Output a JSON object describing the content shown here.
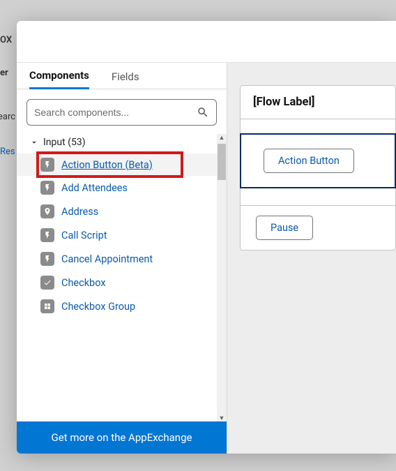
{
  "bg": {
    "left1": "OX",
    "left2": "er",
    "left3": "earc",
    "left4": "Res"
  },
  "tabs": {
    "components": "Components",
    "fields": "Fields"
  },
  "search": {
    "placeholder": "Search components..."
  },
  "section": {
    "label": "Input (53)"
  },
  "items": [
    {
      "label": "Action Button (Beta)",
      "icon": "bolt",
      "highlight": true
    },
    {
      "label": "Add Attendees",
      "icon": "bolt"
    },
    {
      "label": "Address",
      "icon": "pin"
    },
    {
      "label": "Call Script",
      "icon": "bolt"
    },
    {
      "label": "Cancel Appointment",
      "icon": "bolt"
    },
    {
      "label": "Checkbox",
      "icon": "check"
    },
    {
      "label": "Checkbox Group",
      "icon": "group"
    }
  ],
  "footer": "Get more on the AppExchange",
  "canvas": {
    "flow_label": "[Flow Label]",
    "action_button": "Action Button",
    "pause": "Pause"
  }
}
